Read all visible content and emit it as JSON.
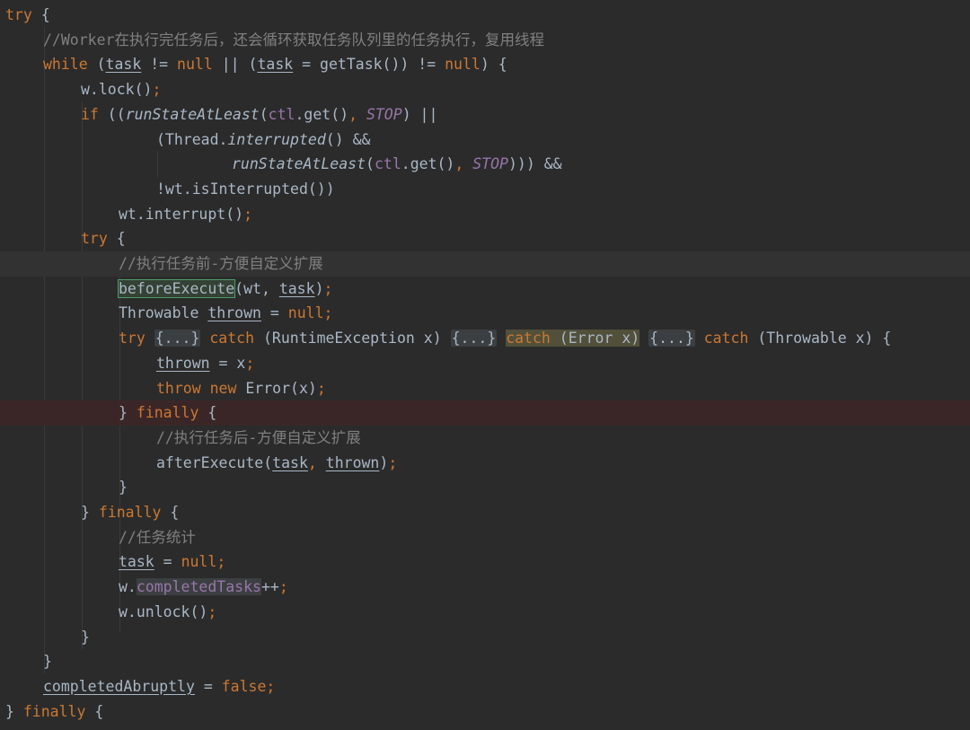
{
  "editor": {
    "colors": {
      "background": "#2b2b2b",
      "keyword": "#cc7832",
      "comment": "#808080",
      "constant": "#9876aa",
      "text": "#a9b7c6"
    },
    "lines": {
      "l1": {
        "kw_try": "try",
        "brace": " {"
      },
      "l2": {
        "comment": "//Worker在执行完任务后，还会循环获取任务队列里的任务执行，复用线程"
      },
      "l3": {
        "kw_while": "while",
        "a": " (",
        "task1": "task",
        "b": " != ",
        "kw_null1": "null",
        "c": " || (",
        "task2": "task",
        "d": " = getTask()) != ",
        "kw_null2": "null",
        "e": ") {"
      },
      "l4": {
        "a": "w.lock()",
        "semi": ";"
      },
      "l5": {
        "kw_if": "if",
        "a": " ((",
        "fn": "runStateAtLeast",
        "b": "(",
        "ctl": "ctl",
        "c": ".get()",
        "comma": ", ",
        "stop": "STOP",
        "d": ") ||"
      },
      "l6": {
        "a": "(Thread.",
        "fn": "interrupted",
        "b": "() &&"
      },
      "l7": {
        "fn": "runStateAtLeast",
        "b": "(",
        "ctl": "ctl",
        "c": ".get()",
        "comma": ", ",
        "stop": "STOP",
        "d": "))) &&"
      },
      "l8": {
        "a": "!wt.isInterrupted())"
      },
      "l9": {
        "a": "wt.interrupt()",
        "semi": ";"
      },
      "l10": {
        "kw_try": "try",
        "brace": " {"
      },
      "l11": {
        "comment": "//执行任务前-方便自定义扩展"
      },
      "l12": {
        "fn": "beforeExecute",
        "a": "(wt, ",
        "task": "task",
        "b": ")",
        "semi": ";"
      },
      "l13": {
        "a": "Throwable ",
        "thrown": "thrown",
        "b": " = ",
        "kw_null": "null",
        "semi": ";"
      },
      "l14": {
        "kw_try": "try",
        "fold1": "{...}",
        "kw_catch1": "catch",
        "a": " (RuntimeException x) ",
        "fold2": "{...}",
        "kw_catch2": "catch",
        "b": " (Error x)",
        "fold3": "{...}",
        "kw_catch3": "catch",
        "c": " (Throwable x) {"
      },
      "l15": {
        "thrown": "thrown",
        "a": " = x",
        "semi": ";"
      },
      "l16": {
        "kw_throw": "throw",
        "kw_new": "new",
        "a": " Error(x)",
        "semi": ";"
      },
      "l17": {
        "a": "} ",
        "kw_finally": "finally",
        "b": " {"
      },
      "l18": {
        "comment": "//执行任务后-方便自定义扩展"
      },
      "l19": {
        "a": "afterExecute(",
        "task": "task",
        "comma": ", ",
        "thrown": "thrown",
        "b": ")",
        "semi": ";"
      },
      "l20": {
        "a": "}"
      },
      "l21": {
        "a": "} ",
        "kw_finally": "finally",
        "b": " {"
      },
      "l22": {
        "comment": "//任务统计"
      },
      "l23": {
        "task": "task",
        "a": " = ",
        "kw_null": "null",
        "semi": ";"
      },
      "l24": {
        "a": "w.",
        "field": "completedTasks",
        "b": "++",
        "semi": ";"
      },
      "l25": {
        "a": "w.unlock()",
        "semi": ";"
      },
      "l26": {
        "a": "}"
      },
      "l27": {
        "a": "}"
      },
      "l28": {
        "var": "completedAbruptly",
        "a": " = ",
        "kw_false": "false",
        "semi": ";"
      },
      "l29": {
        "a": "} ",
        "kw_finally": "finally",
        "b": " {"
      }
    }
  }
}
